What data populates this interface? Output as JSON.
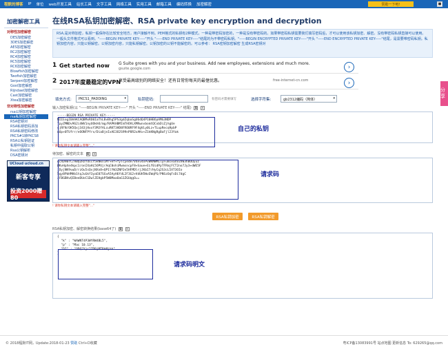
{
  "topnav": {
    "brand": "程默的博客",
    "items": [
      "IP",
      "单位",
      "web开发工具",
      "站长工具",
      "文字工具",
      "网络工具",
      "实用工具",
      "邮箱工具",
      "编码转换",
      "加密解密"
    ],
    "donate": "赞助一下吧!",
    "corner": "■"
  },
  "sidebar": {
    "title": "加密解密工具",
    "groups": [
      {
        "title": "对称性加密解密",
        "items": [
          "DES加密解密",
          "3DES加密解密",
          "AES加密解密",
          "RC2加密解密",
          "RC4加密解密",
          "RC5加密解密",
          "RC6加密解密",
          "Blowfish加密解密",
          "Twofish加密解密",
          "Serpent加密解密",
          "Gost加密解密",
          "Rijndael加密解密",
          "Cast加密解密",
          "Xtea加密解密"
        ]
      },
      {
        "title": "非对称性加密解密",
        "items": [
          "rsa公钥加密解密",
          "rsa私钥加密解密",
          "RSA密钥对",
          "RSA私钥密码添加",
          "RSA私钥密码修改",
          "PKCS#1转PKCS8",
          "RSA公私钥验证",
          "私钥中提取公钥",
          "Rsa公钥解析",
          "DSA密钥对"
        ]
      }
    ],
    "active_item": "rsa私钥加密解密",
    "ad": {
      "head": "UCloud ucloud.cn",
      "line": "新客专享",
      "price": "投资2000赠80"
    }
  },
  "main": {
    "title": "在线RSA私钥加密解密、RSA private key encryption and decryption",
    "description": "RSA,是对称加密，私钥一般保存在比较安全地方，用户接触不到。PEM格式的私钥有2种模式，一种是带密码加密的，一种是没有带密码的。如果带密码私钥需要我们填写密码后，才可以使用该私钥加密、解密。没有带密码私钥直接可以使用。一般头文件格式可以看到。\"-----BEGIN PRIVATE KEY-----\"开头 \"-----END PRIVATE KEY-----\"结尾的为不带密码私钥。\"-----BEGIN ENCRYPTED PRIVATE KEY-----\"开头 \"-----END ENCRYPTED PRIVATE KEY-----\"结尾，是需要带密码私钥。私钥加密内容，只能公钥解密。公钥加密内容，只能私钥解密。公钥加密的公钥不能解密的。可以参考： RSA密钥加密解密 生成RSA密钥对",
    "ads": [
      {
        "num": "1",
        "headline": "Get started now",
        "text": "G Suite grows with you and your business. Add new employees, extensions and much more.",
        "sub": "gsuite.google.com",
        "next": "›"
      },
      {
        "num": "2",
        "headline": "2017年度最稳定的VPN",
        "text": "享受最高级别的网络安全！还有日常你每天的最惬优惠。",
        "sub": "free-internet-cn.com",
        "next": "›"
      }
    ],
    "form": {
      "padding_label": "填充方式:",
      "padding_value": "PKCS1_PADDING",
      "password_label": "私钥密码:",
      "password_value": "",
      "password_hint": "有密码才需要填写",
      "charset_label": "选择字符集:",
      "charset_value": "gb2312编码（简体）",
      "caret": "▾"
    },
    "key": {
      "label": "输入加密私钥(以 \"-----BEGIN PRIVATE KEY-----\" 开头 \"-----END PRIVATE KEY-----\" 结尾)",
      "content": "-----BEGIN RSA PRIVATE KEY-----\nMIIEogIBAAKCAQBMxRO0IaThLBvBhg5PS3gdZqbaSgU6dQ4P10HBOyHMG3NDP\nTpyZMNDv962i4WV1nyUOkH4/mg/RAPKHBMImTHOVLXMRwnvbomtQCxbDiZjhgUe\n4jRFN/OK5Qxj343jHxxY3MJfALcuRKT3HD8FRO0RF9F4gVLy0Lz+TLupRecq9pbP\nnOp+0TUfrr/eOONFPfrx/DiaBjeIxAE3O2S99nPOR2xAKv+Z1kKNgRgBaFjl23Yak"
    },
    "key_warn": "! 请你私钥文本请输入完整\"...\"",
    "enc": {
      "label": "待加密、解密的文本",
      "content": "AcXD9BrC/ABQZHzYdscY5kNkniMr+ef+fyTcyede7V4ev4nPvWKMWM1lyFu8ceaXVZVW3hBUOyuz\nWKvHpXe4kpc1/onIXaHL5OPUjrAqC0ohiMwmsncpF8+Saue+ELf0idPpTFRmjFCT2no7Jy3+dWE5F\njDyjNK9vwD/rzOu5sQvjNXn8+QP1lYW3ZNP2e5HFMDlrjJKbI7/HyCq2S3cL5XT3OIo\n5gy8PbHMHb1tqJuGkf3yaE07SGvA5AyH6fdL2F3G2+VdUH5WvEWqPS/PNSzOqFsDi7dgC\nzFBGBHvQIBeeDUoC1DwlZEHgbP5W8MaaOaG1ZGUqgO=="
    },
    "enc_warn": "! 请你私钥文本请输入完整\"...\"",
    "buttons": {
      "encrypt": "RSA私钥加密",
      "decrypt": "RSA私钥解密"
    },
    "dec": {
      "label": "RSA私钥加密、解密转换结果(base64了)",
      "content": "{\n  \"k\" : \"WAWNT4P3WYRW4BL5\",\n  \"p\" : \"Mac 10.13\",\n  \"DI\" : \"ODQ2Yjc2ZDBjMTRkMjhh\"\n}"
    },
    "icons": {
      "copy": "⧉",
      "clear": "×"
    }
  },
  "annotations": {
    "key": "自己的私钥",
    "enc": "请求码",
    "dec": "请求码明文"
  },
  "share": {
    "label": "分享"
  },
  "footer": {
    "left_prefix": "© 2018程默IT网，Update:2018-01-23",
    "help": "赞助",
    "shortcut": "Ctrl+D收藏",
    "right": "粤ICP备13083991号  站点地图  更新信息  To: 629265@qq.com"
  },
  "colors": {
    "topbar": "#1a66b8",
    "accent": "#f29a2a",
    "annotation": "#1c2b9c",
    "share": "#e8508c"
  }
}
